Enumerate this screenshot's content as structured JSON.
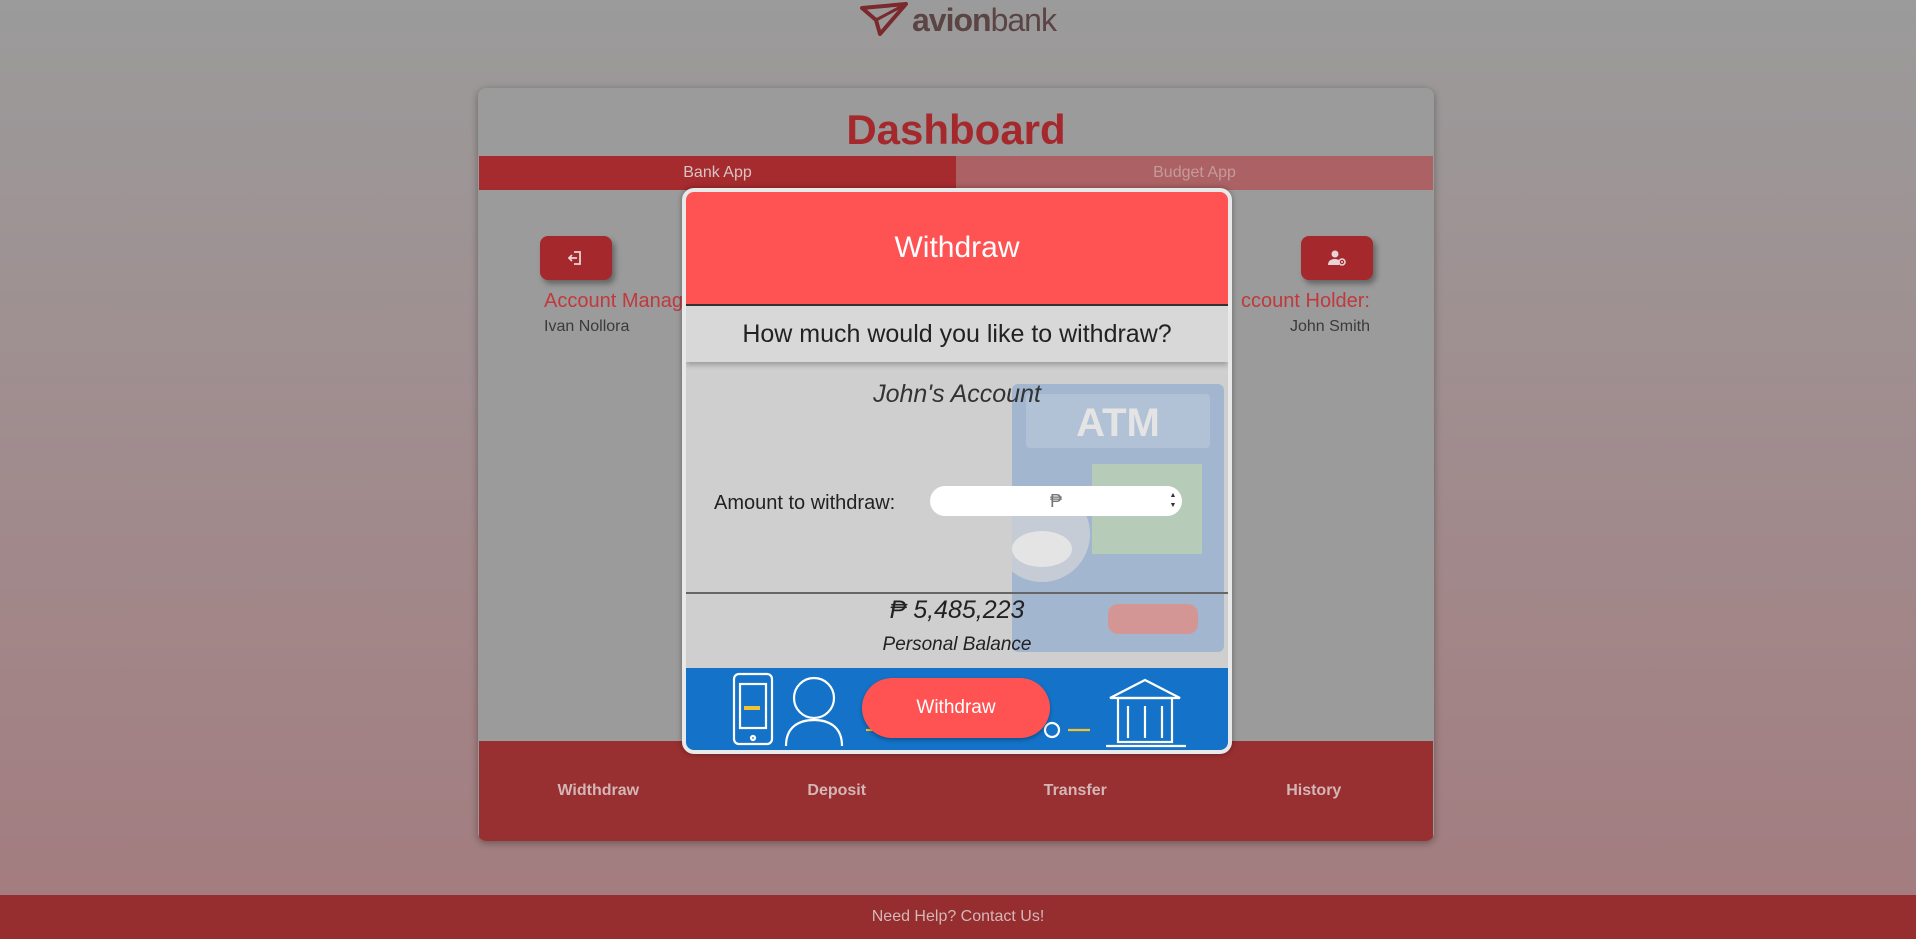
{
  "brand": {
    "logo_prefix": "avion",
    "logo_suffix": "bank"
  },
  "dashboard": {
    "title": "Dashboard",
    "tabs": [
      {
        "label": "Bank App",
        "active": true
      },
      {
        "label": "Budget App",
        "active": false
      }
    ],
    "logout_icon": "logout-icon",
    "user_settings_icon": "user-gear-icon",
    "manager_label": "Account Manag",
    "manager_name": "Ivan Nollora",
    "holder_label": "ccount Holder:",
    "holder_name": "John Smith",
    "nav": [
      "Widthdraw",
      "Deposit",
      "Transfer",
      "History"
    ]
  },
  "modal": {
    "title": "Withdraw",
    "question": "How much would you like to withdraw?",
    "account_name": "John's Account",
    "amount_label": "Amount to withdraw:",
    "amount_placeholder": "₱",
    "balance": "₱ 5,485,223",
    "balance_label": "Personal Balance",
    "submit_label": "Withdraw",
    "atm_sign": "ATM"
  },
  "footer": {
    "help_text": "Need Help? Contact Us!"
  },
  "colors": {
    "accent": "#ff5353",
    "dashboard_red": "#a4282c",
    "banner_blue": "#1473c8"
  }
}
